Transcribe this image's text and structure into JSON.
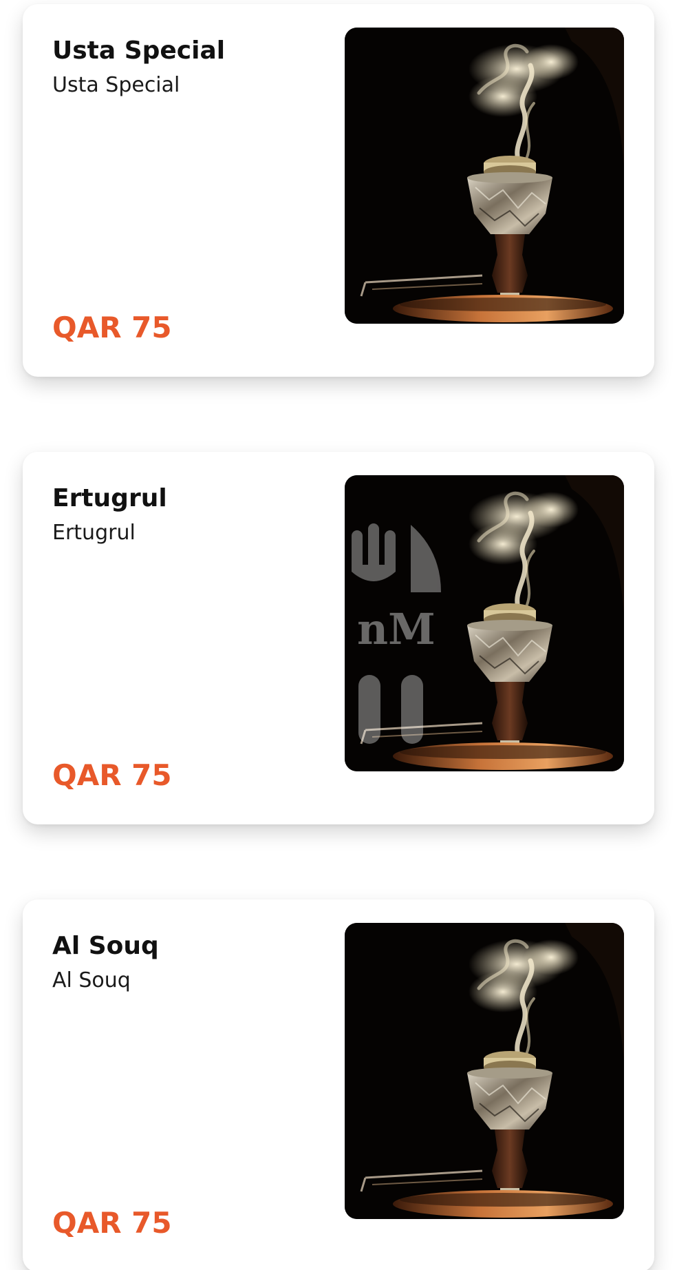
{
  "menu": {
    "items": [
      {
        "title": "Usta Special",
        "subtitle": "Usta Special",
        "price": "QAR 75",
        "image": "hookah-bowl-smoke-image"
      },
      {
        "title": "Ertugrul",
        "subtitle": "Ertugrul",
        "price": "QAR 75",
        "image": "hookah-bowl-smoke-image",
        "watermark": "nM"
      },
      {
        "title": "Al Souq",
        "subtitle": "Al Souq",
        "price": "QAR 75",
        "image": "hookah-bowl-smoke-image"
      }
    ]
  },
  "colors": {
    "price": "#e8592a",
    "card_bg": "#ffffff",
    "image_bg": "#050302"
  }
}
